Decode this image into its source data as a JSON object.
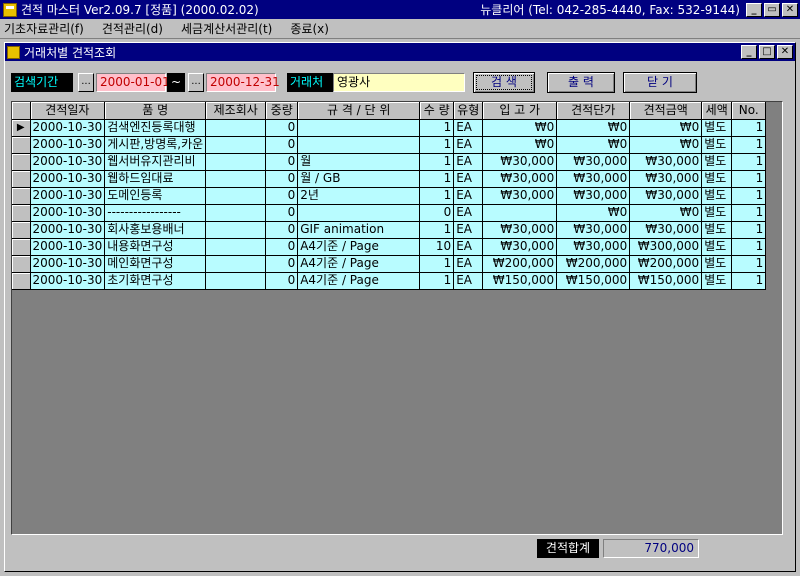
{
  "window": {
    "title": "견적 마스터 Ver2.09.7 [정품] (2000.02.02)",
    "contact": "뉴클리어 (Tel: 042-285-4440, Fax: 532-9144)",
    "buttons": {
      "minimize": "_",
      "restore": "▭",
      "close": "✕"
    }
  },
  "menu": [
    "기초자료관리(f)",
    "견적관리(d)",
    "세금계산서관리(t)",
    "종료(x)"
  ],
  "child_window": {
    "title": "거래처별 견적조회",
    "buttons": {
      "minimize": "_",
      "maximize": "□",
      "close": "✕"
    }
  },
  "search": {
    "period_label": "검색기간",
    "date_from": "2000-01-01",
    "tilde": "~",
    "date_to": "2000-12-31",
    "ellipsis": "...",
    "client_label": "거래처",
    "client_value": "영광사",
    "search_button": "검 색",
    "print_button": "출 력",
    "close_button": "닫 기"
  },
  "grid": {
    "columns": [
      "견적일자",
      "품      명",
      "제조회사",
      "중량",
      "규 격 / 단 위",
      "수 량",
      "유형",
      "입 고 가",
      "견적단가",
      "견적금액",
      "세액",
      "No."
    ],
    "current_row_marker": "▶",
    "rows": [
      [
        "2000-10-30",
        "검색엔진등록대행",
        "",
        "0",
        "",
        "1",
        "EA",
        "₩0",
        "₩0",
        "₩0",
        "별도",
        "1"
      ],
      [
        "2000-10-30",
        "게시판,방명록,카운",
        "",
        "0",
        "",
        "1",
        "EA",
        "₩0",
        "₩0",
        "₩0",
        "별도",
        "1"
      ],
      [
        "2000-10-30",
        "웹서버유지관리비",
        "",
        "0",
        "월",
        "1",
        "EA",
        "₩30,000",
        "₩30,000",
        "₩30,000",
        "별도",
        "1"
      ],
      [
        "2000-10-30",
        "웹하드임대료",
        "",
        "0",
        "월 / GB",
        "1",
        "EA",
        "₩30,000",
        "₩30,000",
        "₩30,000",
        "별도",
        "1"
      ],
      [
        "2000-10-30",
        "도메인등록",
        "",
        "0",
        "2년",
        "1",
        "EA",
        "₩30,000",
        "₩30,000",
        "₩30,000",
        "별도",
        "1"
      ],
      [
        "2000-10-30",
        "-----------------",
        "",
        "0",
        "",
        "0",
        "EA",
        "",
        "₩0",
        "₩0",
        "별도",
        "1"
      ],
      [
        "2000-10-30",
        "회사홍보용배너",
        "",
        "0",
        "GIF animation",
        "1",
        "EA",
        "₩30,000",
        "₩30,000",
        "₩30,000",
        "별도",
        "1"
      ],
      [
        "2000-10-30",
        "내용화면구성",
        "",
        "0",
        "A4기준 / Page",
        "10",
        "EA",
        "₩30,000",
        "₩30,000",
        "₩300,000",
        "별도",
        "1"
      ],
      [
        "2000-10-30",
        "메인화면구성",
        "",
        "0",
        "A4기준 / Page",
        "1",
        "EA",
        "₩200,000",
        "₩200,000",
        "₩200,000",
        "별도",
        "1"
      ],
      [
        "2000-10-30",
        "초기화면구성",
        "",
        "0",
        "A4기준 / Page",
        "1",
        "EA",
        "₩150,000",
        "₩150,000",
        "₩150,000",
        "별도",
        "1"
      ]
    ]
  },
  "total": {
    "label": "견적합계",
    "value": "770,000"
  }
}
